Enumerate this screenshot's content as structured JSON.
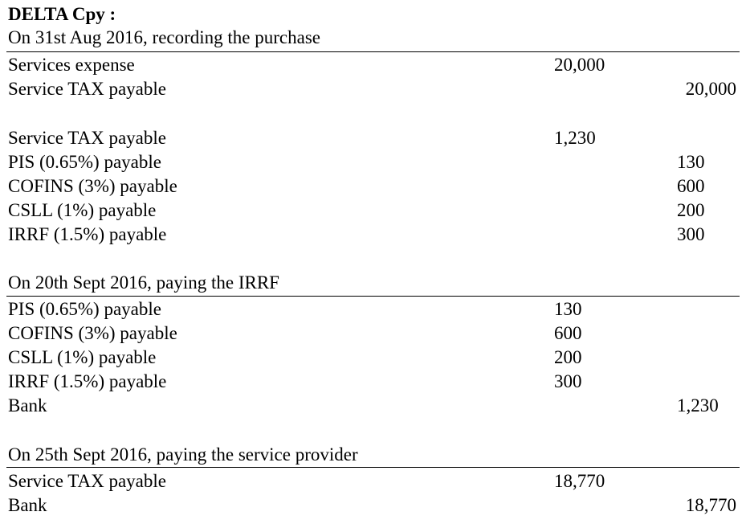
{
  "title": "DELTA Cpy :",
  "sections": [
    {
      "heading": "On 31st Aug 2016, recording the purchase",
      "entries": [
        {
          "account": "Services expense",
          "debit": "20,000",
          "credit": ""
        },
        {
          "account": "Service TAX payable",
          "debit": "",
          "credit": "20,000"
        },
        {
          "account": "Service TAX payable",
          "debit": "1,230",
          "credit": ""
        },
        {
          "account": "PIS (0.65%) payable",
          "debit": "",
          "credit": "130"
        },
        {
          "account": "COFINS (3%) payable",
          "debit": "",
          "credit": "600"
        },
        {
          "account": "CSLL (1%) payable",
          "debit": "",
          "credit": "200"
        },
        {
          "account": "IRRF (1.5%) payable",
          "debit": "",
          "credit": "300"
        }
      ]
    },
    {
      "heading": "On 20th Sept 2016, paying the IRRF",
      "entries": [
        {
          "account": "PIS (0.65%) payable",
          "debit": "130",
          "credit": ""
        },
        {
          "account": "COFINS (3%) payable",
          "debit": "600",
          "credit": ""
        },
        {
          "account": "CSLL (1%) payable",
          "debit": "200",
          "credit": ""
        },
        {
          "account": "IRRF (1.5%) payable",
          "debit": "300",
          "credit": ""
        },
        {
          "account": "Bank",
          "debit": "",
          "credit": "1,230"
        }
      ]
    },
    {
      "heading": "On 25th Sept 2016, paying the service provider",
      "entries": [
        {
          "account": "Service TAX payable",
          "debit": "18,770",
          "credit": ""
        },
        {
          "account": "Bank",
          "debit": "",
          "credit": "18,770"
        }
      ]
    }
  ]
}
